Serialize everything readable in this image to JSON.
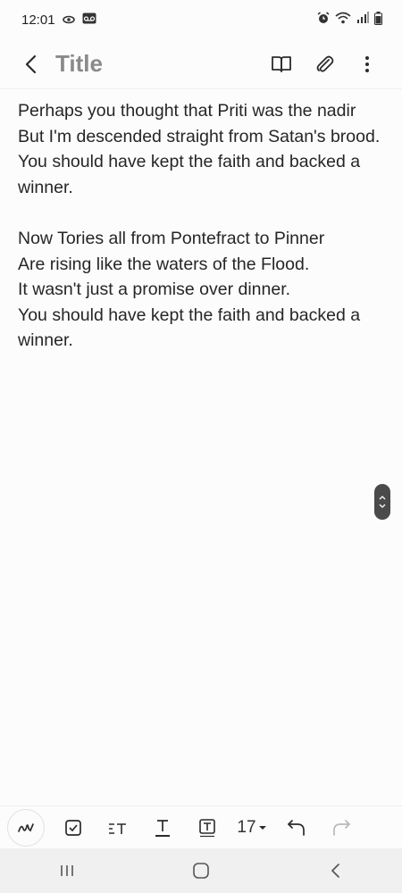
{
  "status_bar": {
    "time": "12:01",
    "left_icons": [
      "eye-icon",
      "voicemail-icon"
    ],
    "right_icons": [
      "alarm-icon",
      "wifi-icon",
      "signal-icon",
      "battery-icon"
    ]
  },
  "app_bar": {
    "title": "Title",
    "icons": [
      "back-icon",
      "reading-mode-icon",
      "attach-icon",
      "more-vert-icon"
    ]
  },
  "note": {
    "lines": [
      "Perhaps you thought that Priti was the nadir",
      "But I'm descended straight from Satan's brood.",
      "You should have kept the faith and backed a winner.",
      "",
      "Now Tories all from Pontefract to Pinner",
      "Are rising like the waters of the Flood.",
      "It wasn't just a promise over dinner.",
      "You should have kept the faith and backed a winner."
    ]
  },
  "toolbar": {
    "tools": [
      "handwriting-icon",
      "checkbox-icon",
      "text-style-icon",
      "underline-text-icon",
      "text-box-icon"
    ],
    "font_size": "17",
    "undo": "undo-icon",
    "redo": "redo-icon"
  },
  "nav_bar": {
    "buttons": [
      "recents-icon",
      "home-icon",
      "back-nav-icon"
    ]
  }
}
